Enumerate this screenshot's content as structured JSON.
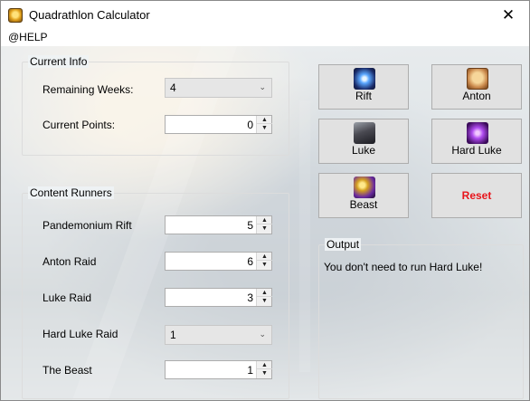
{
  "window": {
    "title": "Quadrathlon Calculator",
    "close_symbol": "✕"
  },
  "menu": {
    "help_label": "@HELP"
  },
  "current_info": {
    "title": "Current Info",
    "remaining_weeks_label": "Remaining Weeks:",
    "remaining_weeks_value": "4",
    "current_points_label": "Current Points:",
    "current_points_value": "0"
  },
  "content_runners": {
    "title": "Content Runners",
    "rows": [
      {
        "label": "Pandemonium Rift",
        "value": "5",
        "control": "spinner"
      },
      {
        "label": "Anton Raid",
        "value": "6",
        "control": "spinner"
      },
      {
        "label": "Luke Raid",
        "value": "3",
        "control": "spinner"
      },
      {
        "label": "Hard Luke Raid",
        "value": "1",
        "control": "dropdown"
      },
      {
        "label": "The Beast",
        "value": "1",
        "control": "spinner"
      }
    ]
  },
  "buttons": {
    "rift": {
      "label": "Rift",
      "icon": "rift-icon"
    },
    "anton": {
      "label": "Anton",
      "icon": "anton-icon"
    },
    "luke": {
      "label": "Luke",
      "icon": "luke-icon"
    },
    "hard_luke": {
      "label": "Hard Luke",
      "icon": "hard-luke-icon"
    },
    "beast": {
      "label": "Beast",
      "icon": "beast-icon"
    },
    "reset": {
      "label": "Reset",
      "color": "#e8141b"
    }
  },
  "output": {
    "title": "Output",
    "text": "You don't need to run Hard Luke!"
  },
  "glyphs": {
    "chevron": "⌄",
    "up": "▲",
    "down": "▼"
  }
}
